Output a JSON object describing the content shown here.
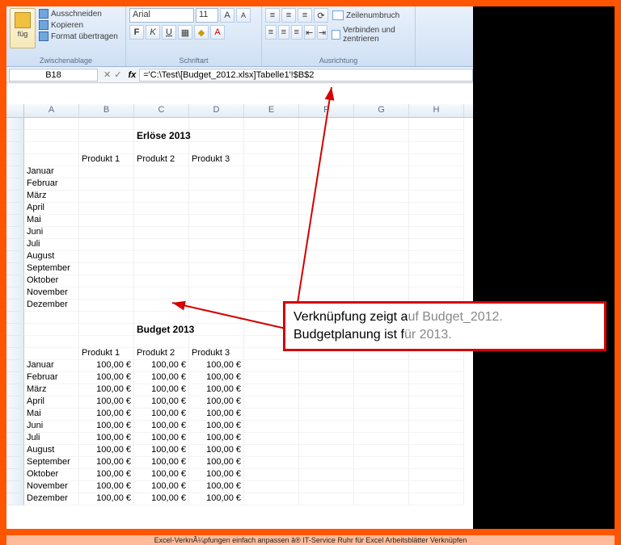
{
  "ribbon": {
    "clipboard": {
      "paste": "füg",
      "cut": "Ausschneiden",
      "copy": "Kopieren",
      "format_painter": "Format übertragen",
      "group_label": "Zwischenablage"
    },
    "font": {
      "name": "Arial",
      "size": "11",
      "group_label": "Schriftart"
    },
    "alignment": {
      "wrap": "Zeilenumbruch",
      "merge": "Verbinden und zentrieren",
      "group_label": "Ausrichtung"
    }
  },
  "formulabar": {
    "namebox": "B18",
    "fx": "fx",
    "formula": "='C:\\Test\\[Budget_2012.xlsx]Tabelle1'!$B$2"
  },
  "columns": [
    "A",
    "B",
    "C",
    "D",
    "E",
    "F",
    "G",
    "H"
  ],
  "erloese": {
    "title": "Erlöse 2013",
    "headers": [
      "Produkt 1",
      "Produkt 2",
      "Produkt 3"
    ],
    "months": [
      "Januar",
      "Februar",
      "März",
      "April",
      "Mai",
      "Juni",
      "Juli",
      "August",
      "September",
      "Oktober",
      "November",
      "Dezember"
    ]
  },
  "budget": {
    "title": "Budget 2013",
    "headers": [
      "Produkt 1",
      "Produkt 2",
      "Produkt 3"
    ],
    "rows": [
      {
        "month": "Januar",
        "v": [
          "100,00 €",
          "100,00 €",
          "100,00 €"
        ]
      },
      {
        "month": "Februar",
        "v": [
          "100,00 €",
          "100,00 €",
          "100,00 €"
        ]
      },
      {
        "month": "März",
        "v": [
          "100,00 €",
          "100,00 €",
          "100,00 €"
        ]
      },
      {
        "month": "April",
        "v": [
          "100,00 €",
          "100,00 €",
          "100,00 €"
        ]
      },
      {
        "month": "Mai",
        "v": [
          "100,00 €",
          "100,00 €",
          "100,00 €"
        ]
      },
      {
        "month": "Juni",
        "v": [
          "100,00 €",
          "100,00 €",
          "100,00 €"
        ]
      },
      {
        "month": "Juli",
        "v": [
          "100,00 €",
          "100,00 €",
          "100,00 €"
        ]
      },
      {
        "month": "August",
        "v": [
          "100,00 €",
          "100,00 €",
          "100,00 €"
        ]
      },
      {
        "month": "September",
        "v": [
          "100,00 €",
          "100,00 €",
          "100,00 €"
        ]
      },
      {
        "month": "Oktober",
        "v": [
          "100,00 €",
          "100,00 €",
          "100,00 €"
        ]
      },
      {
        "month": "November",
        "v": [
          "100,00 €",
          "100,00 €",
          "100,00 €"
        ]
      },
      {
        "month": "Dezember",
        "v": [
          "100,00 €",
          "100,00 €",
          "100,00 €"
        ]
      }
    ]
  },
  "annotation": {
    "line1a": "Verknüpfung zeigt a",
    "line1b": "uf Budget_2012.",
    "line2a": "Budgetplanung ist f",
    "line2b": "ür 2013."
  },
  "caption": "Excel-VerknÃ¼pfungen einfach anpassen â® IT-Service Ruhr für Excel Arbeitsblätter Verknüpfen"
}
